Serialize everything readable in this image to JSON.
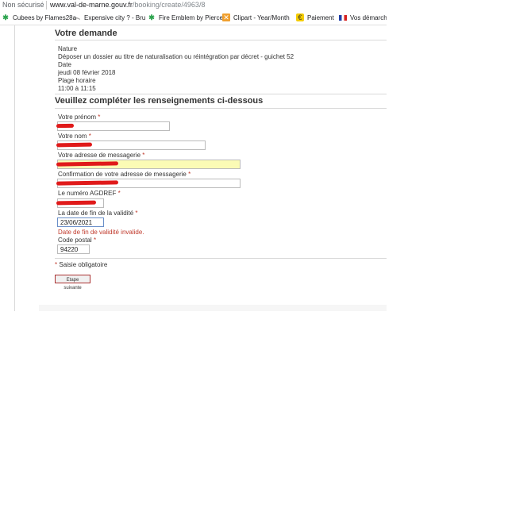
{
  "browser": {
    "security_label": "Non sécurisé",
    "url_host": "www.val-de-marne.gouv.fr",
    "url_path": "/booking/create/4963/8"
  },
  "bookmarks": [
    {
      "label": "Cubees by Flames28a",
      "icon": "puzzle-icon"
    },
    {
      "label": "Expensive city ? - Bru",
      "icon": "mustache-icon"
    },
    {
      "label": "Fire Emblem by Pierce",
      "icon": "puzzle-icon"
    },
    {
      "label": "Clipart - Year/Month",
      "icon": "clipart-icon"
    },
    {
      "label": "Paiement",
      "icon": "payment-icon"
    },
    {
      "label": "Vos démarches",
      "icon": "french-flag-icon"
    }
  ],
  "request": {
    "heading": "Votre demande",
    "nature_label": "Nature",
    "nature_value": "Déposer un dossier au titre de naturalisation ou réintégration par décret - guichet 52",
    "date_label": "Date",
    "date_value": "jeudi 08 février 2018",
    "slot_label": "Plage horaire",
    "slot_value": "11:00 à 11:15"
  },
  "form": {
    "heading": "Veuillez compléter les renseignements ci-dessous",
    "required_marker": "*",
    "firstname_label": "Votre prénom",
    "lastname_label": "Votre nom",
    "email_label": "Votre adresse de messagerie",
    "email_confirm_label": "Confirmation de votre adresse de messagerie",
    "agdref_label": "Le numéro AGDREF",
    "validity_label": "La date de fin de la validité",
    "validity_value": "23/06/2021",
    "validity_error": "Date de fin de validité invalide.",
    "postal_label": "Code postal",
    "postal_value": "94220",
    "mandatory_note": "Saisie obligatoire",
    "next_button": "Etape suivante"
  }
}
